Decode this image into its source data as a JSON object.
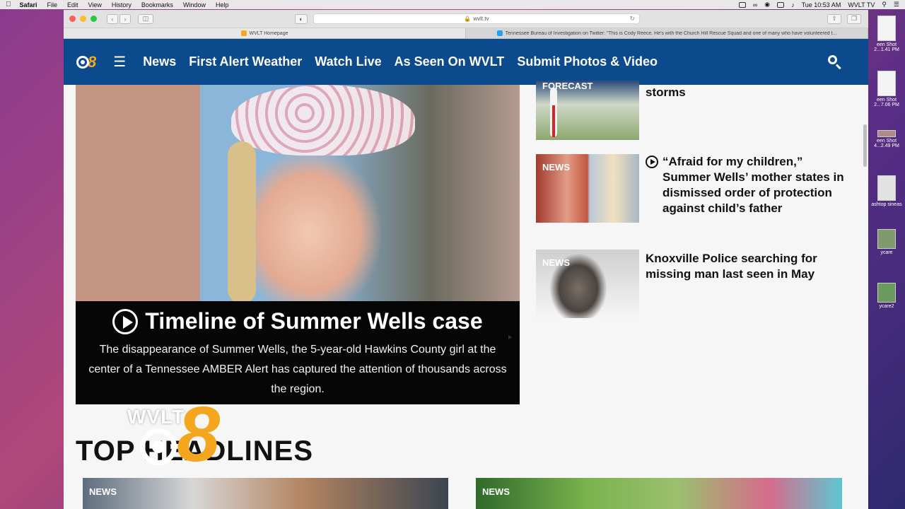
{
  "menubar": {
    "app": "Safari",
    "items": [
      "File",
      "Edit",
      "View",
      "History",
      "Bookmarks",
      "Window",
      "Help"
    ],
    "clock": "Tue 10:53 AM",
    "user": "WVLT TV"
  },
  "browser": {
    "url": "wvlt.tv",
    "tabs": [
      {
        "label": "WVLT Homepage",
        "favicon_color": "#f3a61e"
      },
      {
        "label": "Tennessee Bureau of Investigation on Twitter: \"This is Cody Reece. He's with the Church Hill Rescue Squad and one of many who have volunteered t...",
        "favicon_color": "#1da1f2"
      }
    ]
  },
  "site": {
    "logo_number": "8",
    "nav": [
      "News",
      "First Alert Weather",
      "Watch Live",
      "As Seen On WVLT",
      "Submit Photos & Video"
    ]
  },
  "hero": {
    "title": "Timeline of Summer Wells case",
    "description": "The disappearance of Summer Wells, the 5-year-old Hawkins County girl at the center of a Tennessee AMBER Alert has captured the attention of thousands across the region."
  },
  "stories": [
    {
      "label": "FORECAST",
      "headline": "storms",
      "video": false
    },
    {
      "label": "NEWS",
      "headline": "“Afraid for my children,” Summer Wells’ mother states in dismissed order of protection against child’s father",
      "video": true
    },
    {
      "label": "NEWS",
      "headline": "Knoxville Police searching for missing man last seen in May",
      "video": false
    }
  ],
  "section": {
    "title": "TOP HEADLINES"
  },
  "bottom_cards": [
    {
      "label": "NEWS"
    },
    {
      "label": "NEWS"
    }
  ],
  "watermark": {
    "text": "WVLT",
    "number": "8"
  },
  "desktop": [
    {
      "label": "een Shot 2...1.41 PM"
    },
    {
      "label": "een Shot 2...7.06 PM"
    },
    {
      "label": "een Shot 4...2.49 PM"
    },
    {
      "label": "ashtop sineas"
    },
    {
      "label": "ycare"
    },
    {
      "label": "ycare2"
    }
  ],
  "colors": {
    "nav_bg": "#0b4a8c",
    "brand_orange": "#f3a61e"
  }
}
